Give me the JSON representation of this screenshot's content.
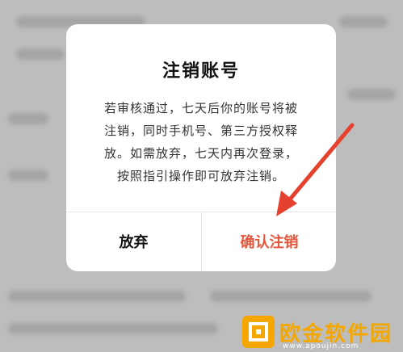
{
  "dialog": {
    "title": "注销账号",
    "body_lines": [
      "若审核通过，七天后你的账号将被",
      "注销，同时手机号、第三方授权释",
      "放。如需放弃，七天内再次登录，",
      "按照指引操作即可放弃注销。"
    ],
    "cancel_label": "放弃",
    "confirm_label": "确认注销"
  },
  "colors": {
    "confirm": "#e5563d",
    "arrow": "#e5412e",
    "watermark": "#f5a700"
  },
  "watermark": {
    "brand": "欧金软件园",
    "url": "www.apoujin.com"
  }
}
